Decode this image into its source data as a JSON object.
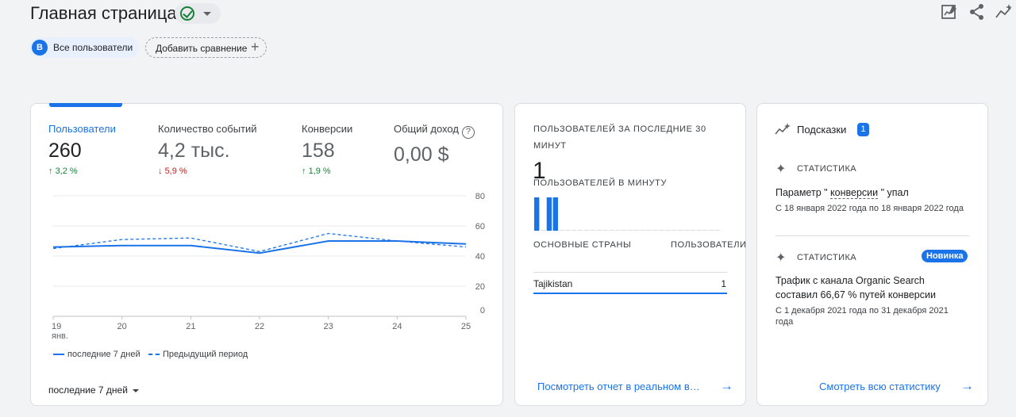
{
  "header": {
    "title": "Главная страница",
    "icons": [
      "check-circle-icon",
      "chevron-down-icon",
      "customize-report-icon",
      "share-icon",
      "insights-icon"
    ]
  },
  "segments": {
    "avatar_letter": "B",
    "segment_label": "Все пользователи",
    "compare_label": "Добавить сравнение",
    "compare_plus": "+"
  },
  "metrics": [
    {
      "label": "Пользователи",
      "value": "260",
      "change": "3,2 %",
      "direction": "up"
    },
    {
      "label": "Количество событий",
      "value": "4,2 тыс.",
      "change": "5,9 %",
      "direction": "down"
    },
    {
      "label": "Конверсии",
      "value": "158",
      "change": "1,9 %",
      "direction": "up"
    },
    {
      "label": "Общий доход",
      "value": "0,00 $"
    }
  ],
  "legend": {
    "current": "последние 7 дней",
    "previous": "Предыдущий период"
  },
  "period_select": "последние 7 дней",
  "chart_data": {
    "type": "line",
    "x": [
      "19",
      "20",
      "21",
      "22",
      "23",
      "24",
      "25"
    ],
    "x_sublabel": "янв.",
    "series": [
      {
        "name": "последние 7 дней",
        "values": [
          46,
          47,
          47,
          42,
          50,
          50,
          48
        ],
        "style": "solid"
      },
      {
        "name": "Предыдущий период",
        "values": [
          45,
          51,
          52,
          43,
          55,
          50,
          46
        ],
        "style": "dashed"
      }
    ],
    "y_ticks": [
      "80",
      "60",
      "40",
      "20",
      "0"
    ],
    "ylim": [
      0,
      80
    ],
    "color": "#1a73e8",
    "grid": true
  },
  "realtime": {
    "title": "ПОЛЬЗОВАТЕЛЕЙ ЗА ПОСЛЕДНИЕ 30 МИНУТ",
    "value": "1",
    "subtitle": "ПОЛЬЗОВАТЕЛЕЙ В МИНУТУ",
    "per_minute": [
      1,
      0,
      1,
      1,
      0,
      0,
      0,
      0,
      0,
      0,
      0,
      0,
      0,
      0,
      0,
      0,
      0,
      0,
      0,
      0,
      0,
      0,
      0,
      0,
      0,
      0,
      0,
      0,
      0,
      0
    ],
    "countries_header": "ОСНОВНЫЕ СТРАНЫ",
    "users_header": "ПОЛЬЗОВАТЕЛИ",
    "country": "Tajikistan",
    "country_value": "1",
    "link": "Посмотреть отчет в реальном в…"
  },
  "insights": {
    "title": "Подсказки",
    "count": "1",
    "items": [
      {
        "kind": "СТАТИСТИКА",
        "head_pre": "Параметр \" ",
        "head_term": "конверсии",
        "head_post": " \" упал",
        "date": "С 18 января 2022 года по 18 января 2022 года"
      },
      {
        "kind": "СТАТИСТИКА",
        "badge": "Новинка",
        "head": "Трафик с канала Organic Search составил 66,67 % путей конверсии",
        "date": "С 1 декабря 2021 года по 31 декабря 2021 года"
      }
    ],
    "link": "Смотреть всю статистику"
  }
}
